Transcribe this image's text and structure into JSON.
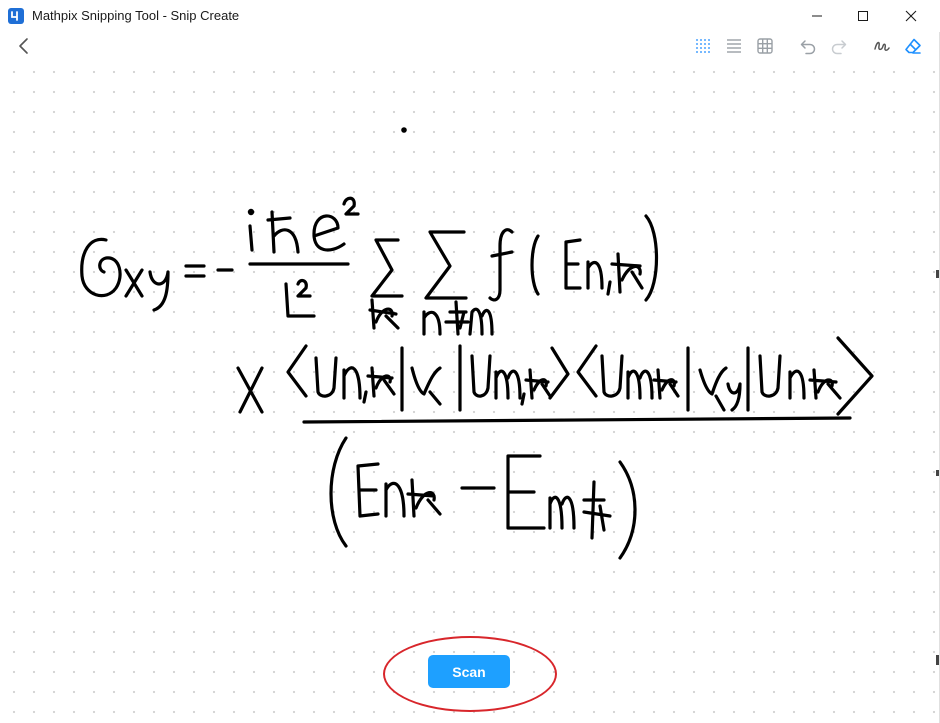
{
  "window": {
    "title": "Mathpix Snipping Tool - Snip Create"
  },
  "titlebar": {
    "controls": [
      "minimize-icon",
      "maximize-icon",
      "close-icon"
    ]
  },
  "toolbar": {
    "left": [
      "back-arrow-icon"
    ],
    "right": [
      "dot-grid-icon",
      "lined-paper-icon",
      "square-grid-icon",
      "undo-icon",
      "redo-icon",
      "pen-icon",
      "eraser-icon"
    ],
    "active_tool": "eraser-icon"
  },
  "canvas": {
    "background": "dot-grid",
    "content": "handwritten-formula"
  },
  "actions": {
    "scan_label": "Scan"
  },
  "colors": {
    "accent": "#1ea0ff",
    "highlight": "#d8262b",
    "toolbar_icon": "#9aa0a6",
    "active_icon": "#1e90ff"
  }
}
